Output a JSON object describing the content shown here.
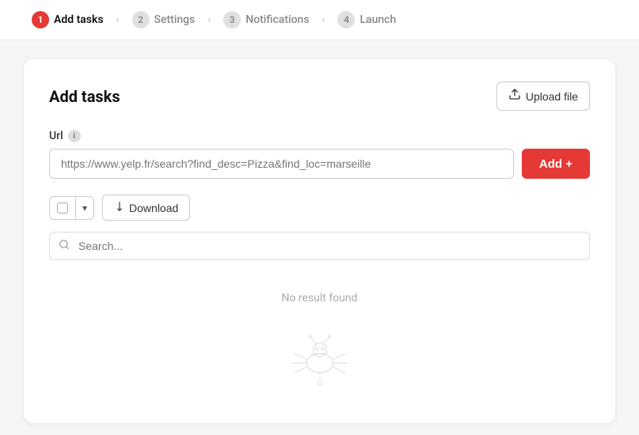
{
  "stepper": {
    "steps": [
      {
        "number": "1",
        "label": "Add tasks",
        "active": true
      },
      {
        "number": "2",
        "label": "Settings",
        "active": false
      },
      {
        "number": "3",
        "label": "Notifications",
        "active": false
      },
      {
        "number": "4",
        "label": "Launch",
        "active": false
      }
    ]
  },
  "card": {
    "title": "Add tasks",
    "upload_button": "Upload file",
    "url_label": "Url",
    "url_placeholder": "https://www.yelp.fr/search?find_desc=Pizza&find_loc=marseille",
    "add_button": "Add +",
    "download_button": "Download",
    "search_placeholder": "Search...",
    "empty_text": "No result found"
  },
  "icons": {
    "info": "i",
    "upload": "↑",
    "download_arrow": "↓",
    "search": "⌕",
    "chevron": "›"
  },
  "colors": {
    "accent": "#e53935",
    "inactive_step": "#888",
    "active_step_bg": "#e53935"
  }
}
